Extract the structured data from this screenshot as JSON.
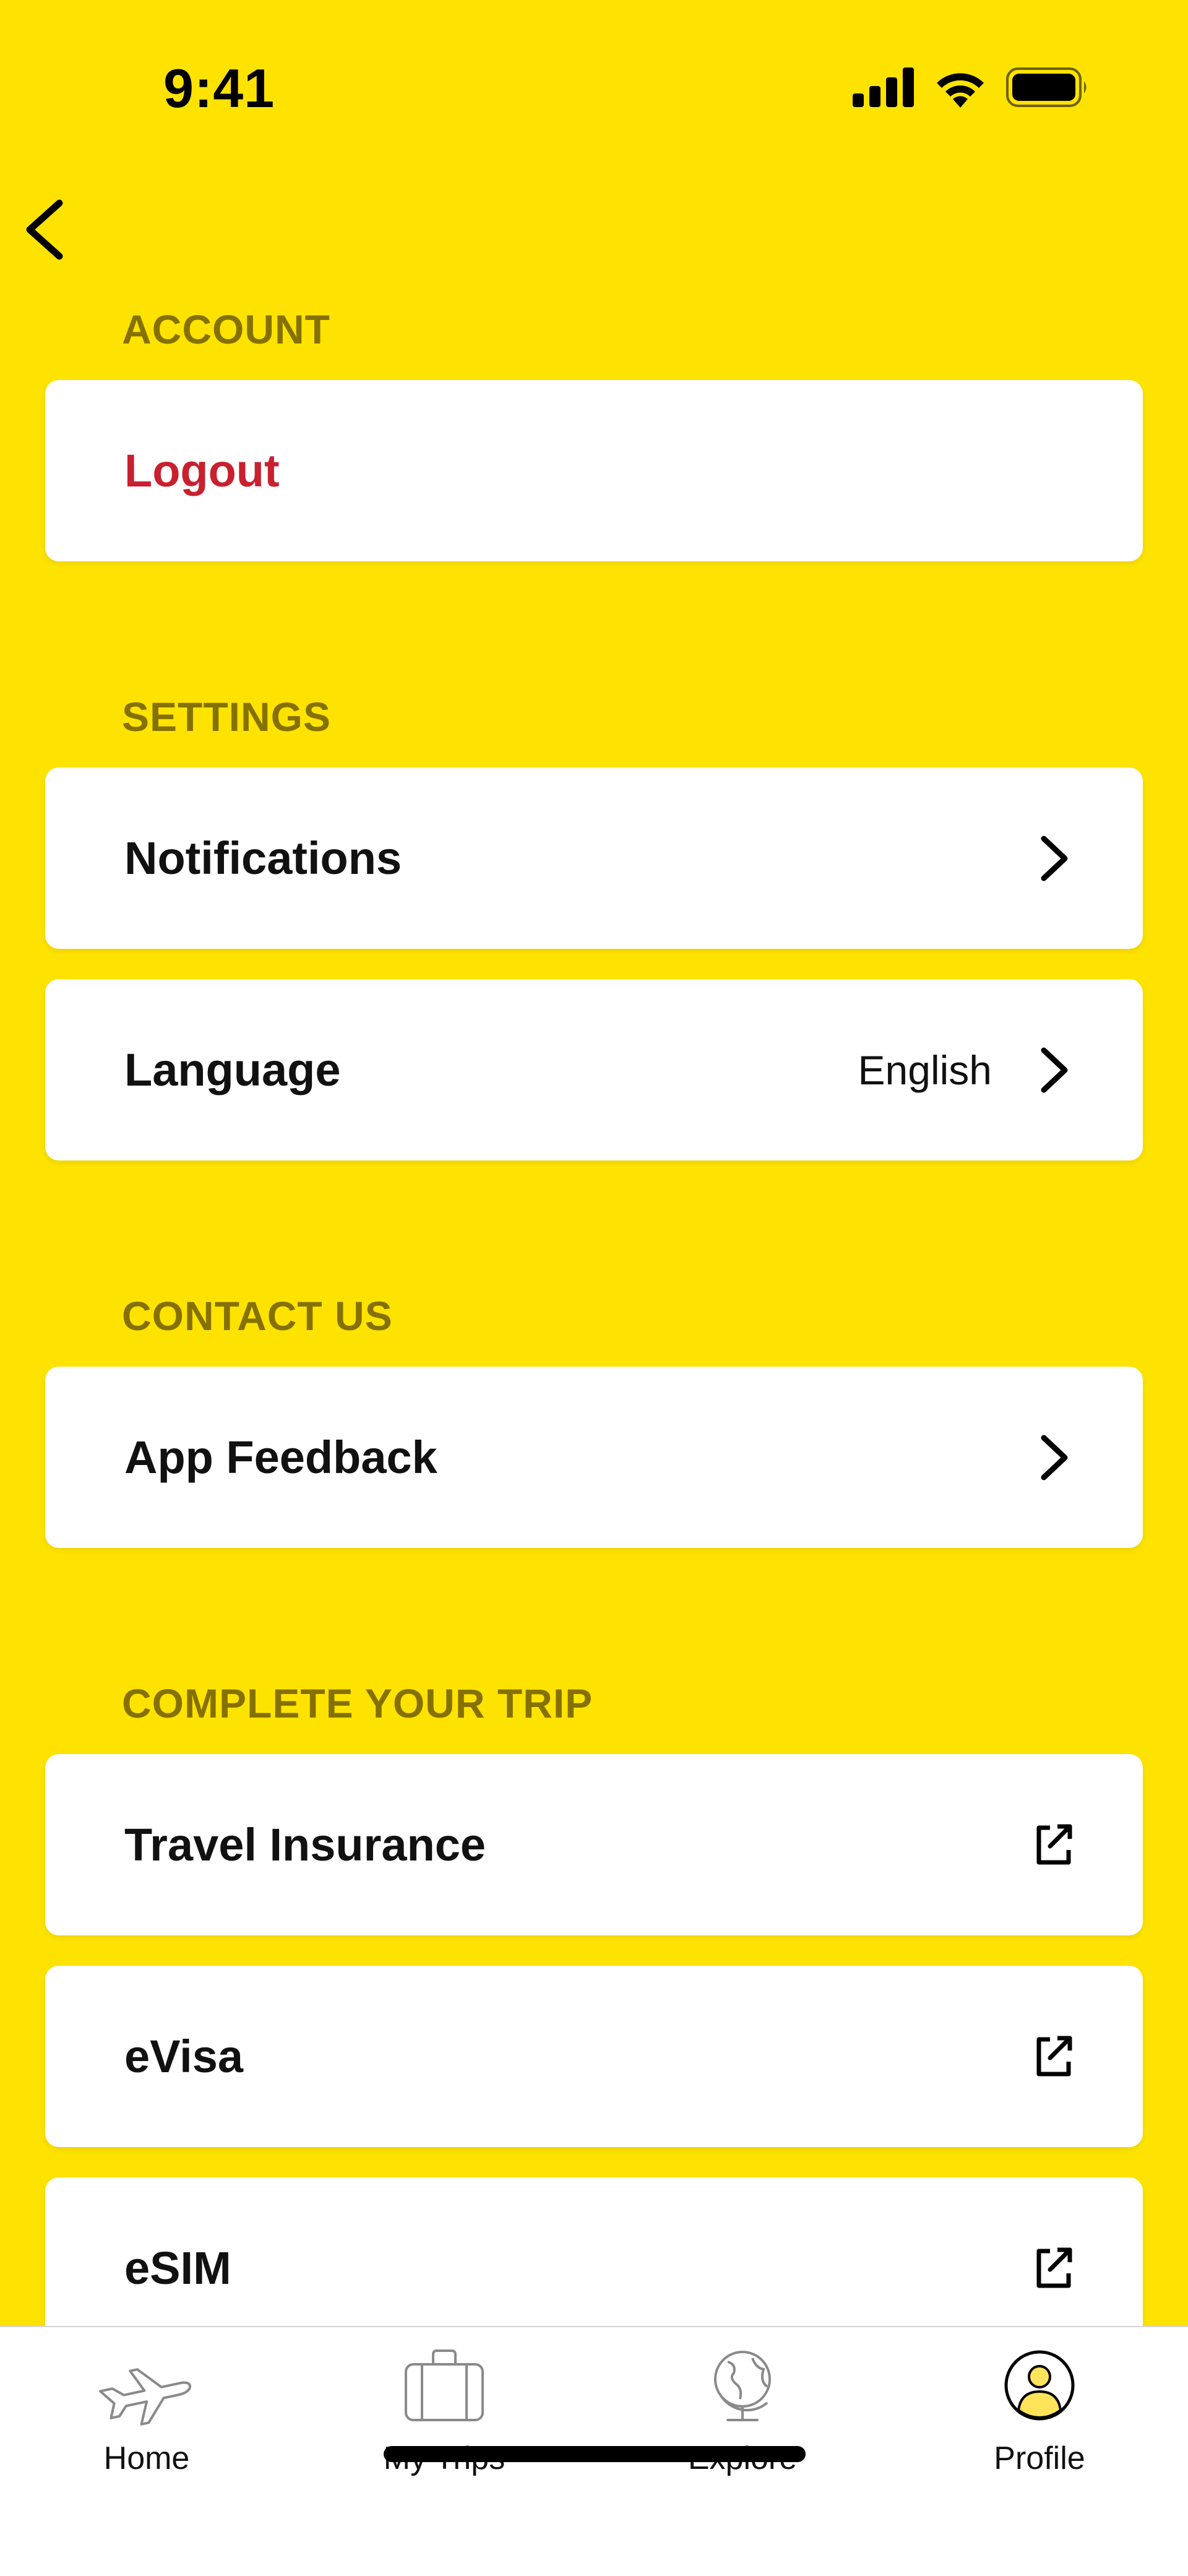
{
  "status_bar": {
    "time": "9:41"
  },
  "sections": {
    "account": {
      "header": "ACCOUNT",
      "items": [
        {
          "label": "Logout"
        }
      ]
    },
    "settings": {
      "header": "SETTINGS",
      "items": [
        {
          "label": "Notifications",
          "icon": "chevron-right-icon"
        },
        {
          "label": "Language",
          "value": "English",
          "icon": "chevron-right-icon"
        }
      ]
    },
    "contact": {
      "header": "CONTACT US",
      "items": [
        {
          "label": "App Feedback",
          "icon": "chevron-right-icon"
        }
      ]
    },
    "trip": {
      "header": "COMPLETE YOUR TRIP",
      "items": [
        {
          "label": "Travel Insurance",
          "icon": "external-link-icon"
        },
        {
          "label": "eVisa",
          "icon": "external-link-icon"
        },
        {
          "label": "eSIM",
          "icon": "external-link-icon"
        }
      ]
    }
  },
  "tab_bar": {
    "tabs": [
      {
        "label": "Home",
        "icon": "airplane-icon"
      },
      {
        "label": "My Trips",
        "icon": "suitcase-icon"
      },
      {
        "label": "Explore",
        "icon": "globe-icon"
      },
      {
        "label": "Profile",
        "icon": "profile-icon",
        "active": true
      }
    ]
  },
  "colors": {
    "background": "#FFE300",
    "section_header": "#857100",
    "danger": "#C8202F",
    "card": "#FFFFFF"
  }
}
